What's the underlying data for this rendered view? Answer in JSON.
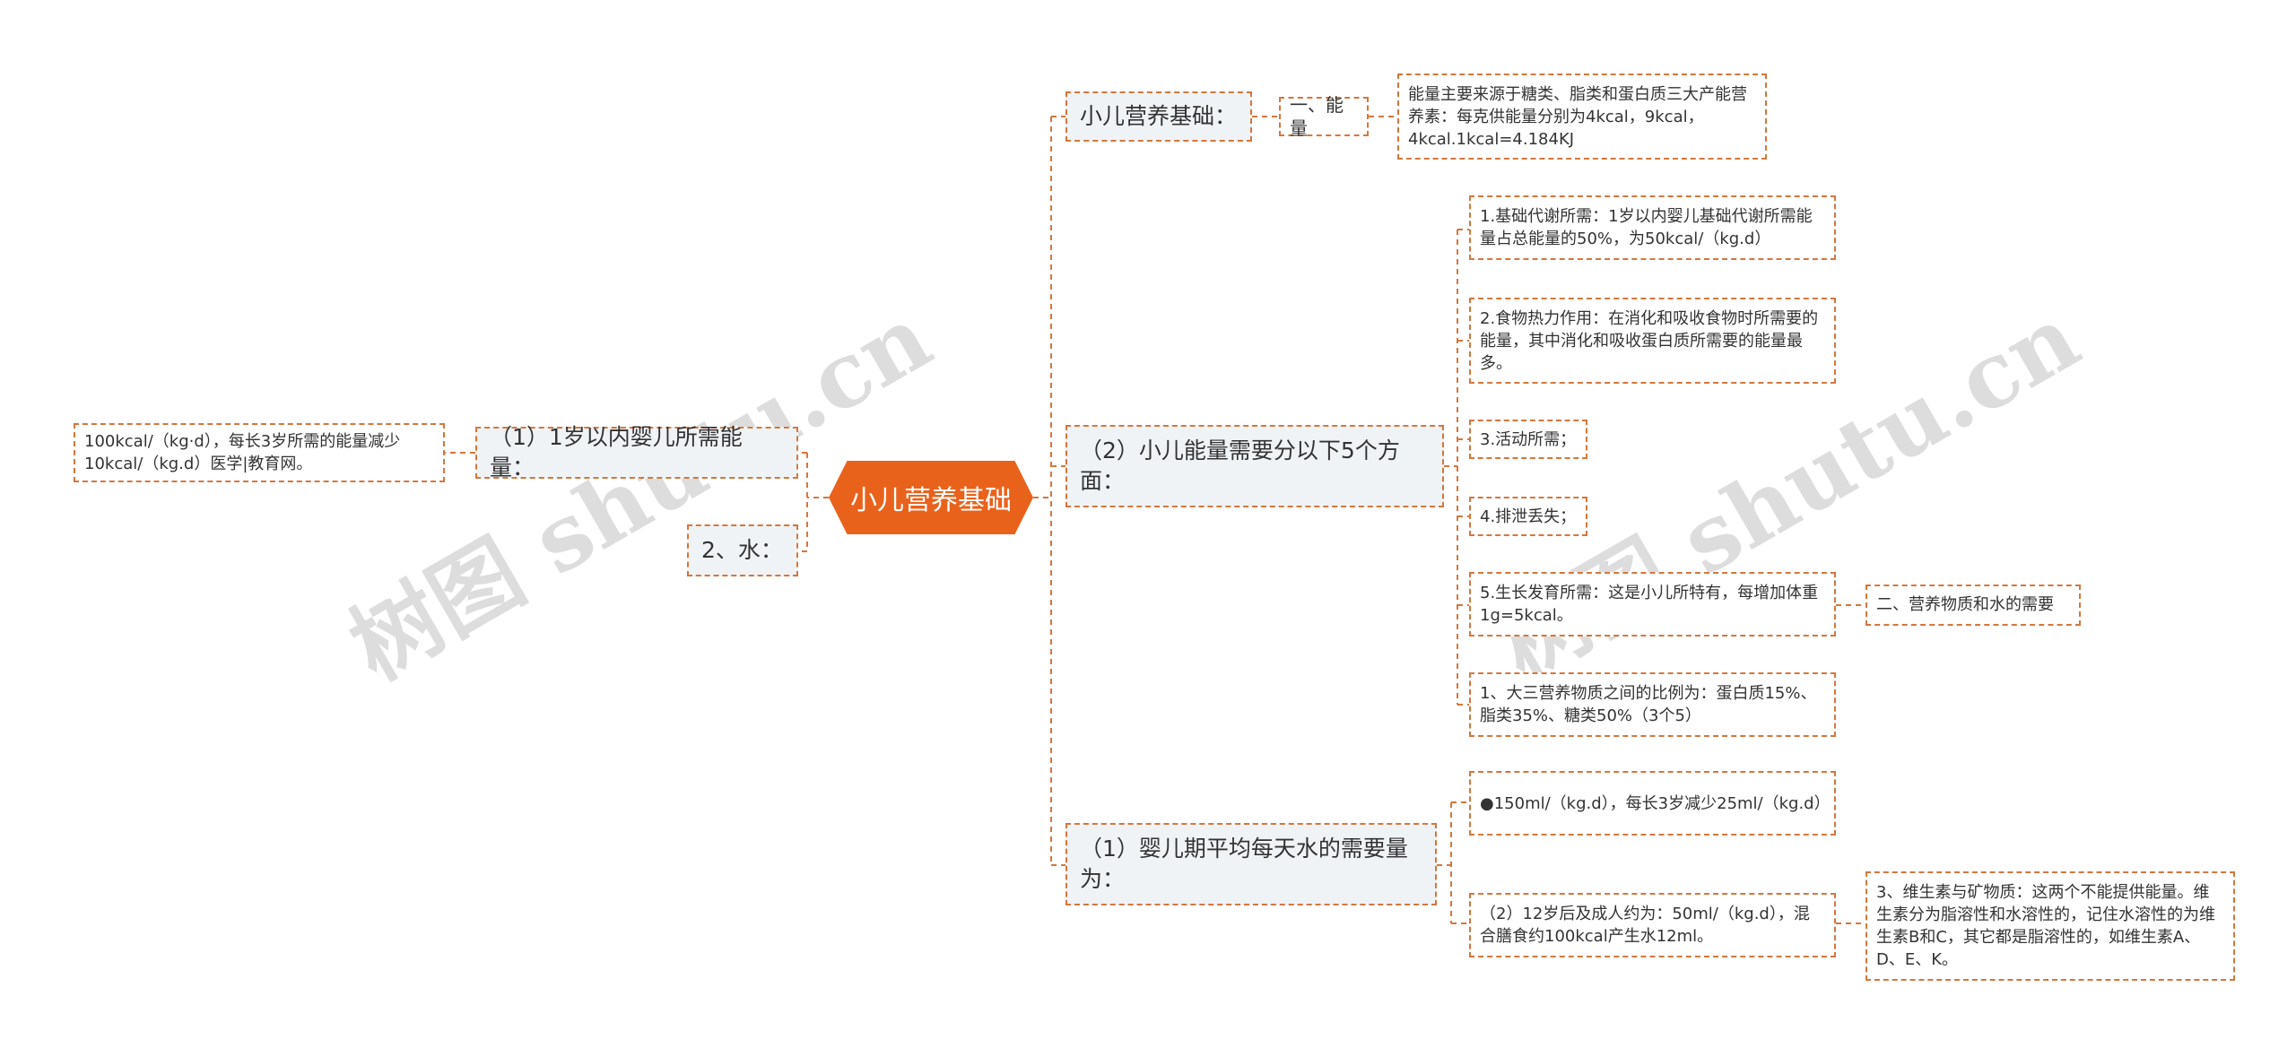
{
  "watermark": "树图 shutu.cn",
  "colors": {
    "root_fill": "#e9621c",
    "border": "#d4773d",
    "level1_fill": "#f0f3f6",
    "text": "#333333"
  },
  "mindmap": {
    "root": "小儿营养基础",
    "left": {
      "energy_under1": {
        "label": "（1）1岁以内婴儿所需能量：",
        "detail": "100kcal/（kg·d），每长3岁所需的能量减少10kcal/（kg.d）医学|教育网。"
      },
      "water": {
        "label": "2、水："
      }
    },
    "right": {
      "nutrition_basics": {
        "label": "小儿营养基础：",
        "child": "一、能量",
        "detail": "能量主要来源于糖类、脂类和蛋白质三大产能营养素：每克供能量分别为4kcal，9kcal，4kcal.1kcal=4.184KJ"
      },
      "energy_needs": {
        "label": "（2）小儿能量需要分以下5个方面：",
        "items": [
          "1.基础代谢所需：1岁以内婴儿基础代谢所需能量占总能量的50%，为50kcal/（kg.d）",
          "2.食物热力作用：在消化和吸收食物时所需要的能量，其中消化和吸收蛋白质所需要的能量最多。",
          "3.活动所需；",
          "4.排泄丢失；",
          "5.生长发育所需：这是小儿所特有，每增加体重1g=5kcal。",
          "1、大三营养物质之间的比例为：蛋白质15%、脂类35%、糖类50%（3个5）"
        ],
        "item5_child": "二、营养物质和水的需要"
      },
      "water_needs": {
        "label": "（1）婴儿期平均每天水的需要量为：",
        "items": [
          "●150ml/（kg.d），每长3岁减少25ml/（kg.d）",
          "（2）12岁后及成人约为：50ml/（kg.d），混合膳食约100kcal产生水12ml。"
        ],
        "item2_child": "3、维生素与矿物质：这两个不能提供能量。维生素分为脂溶性和水溶性的，记住水溶性的为维生素B和C，其它都是脂溶性的，如维生素A、D、E、K。"
      }
    }
  }
}
